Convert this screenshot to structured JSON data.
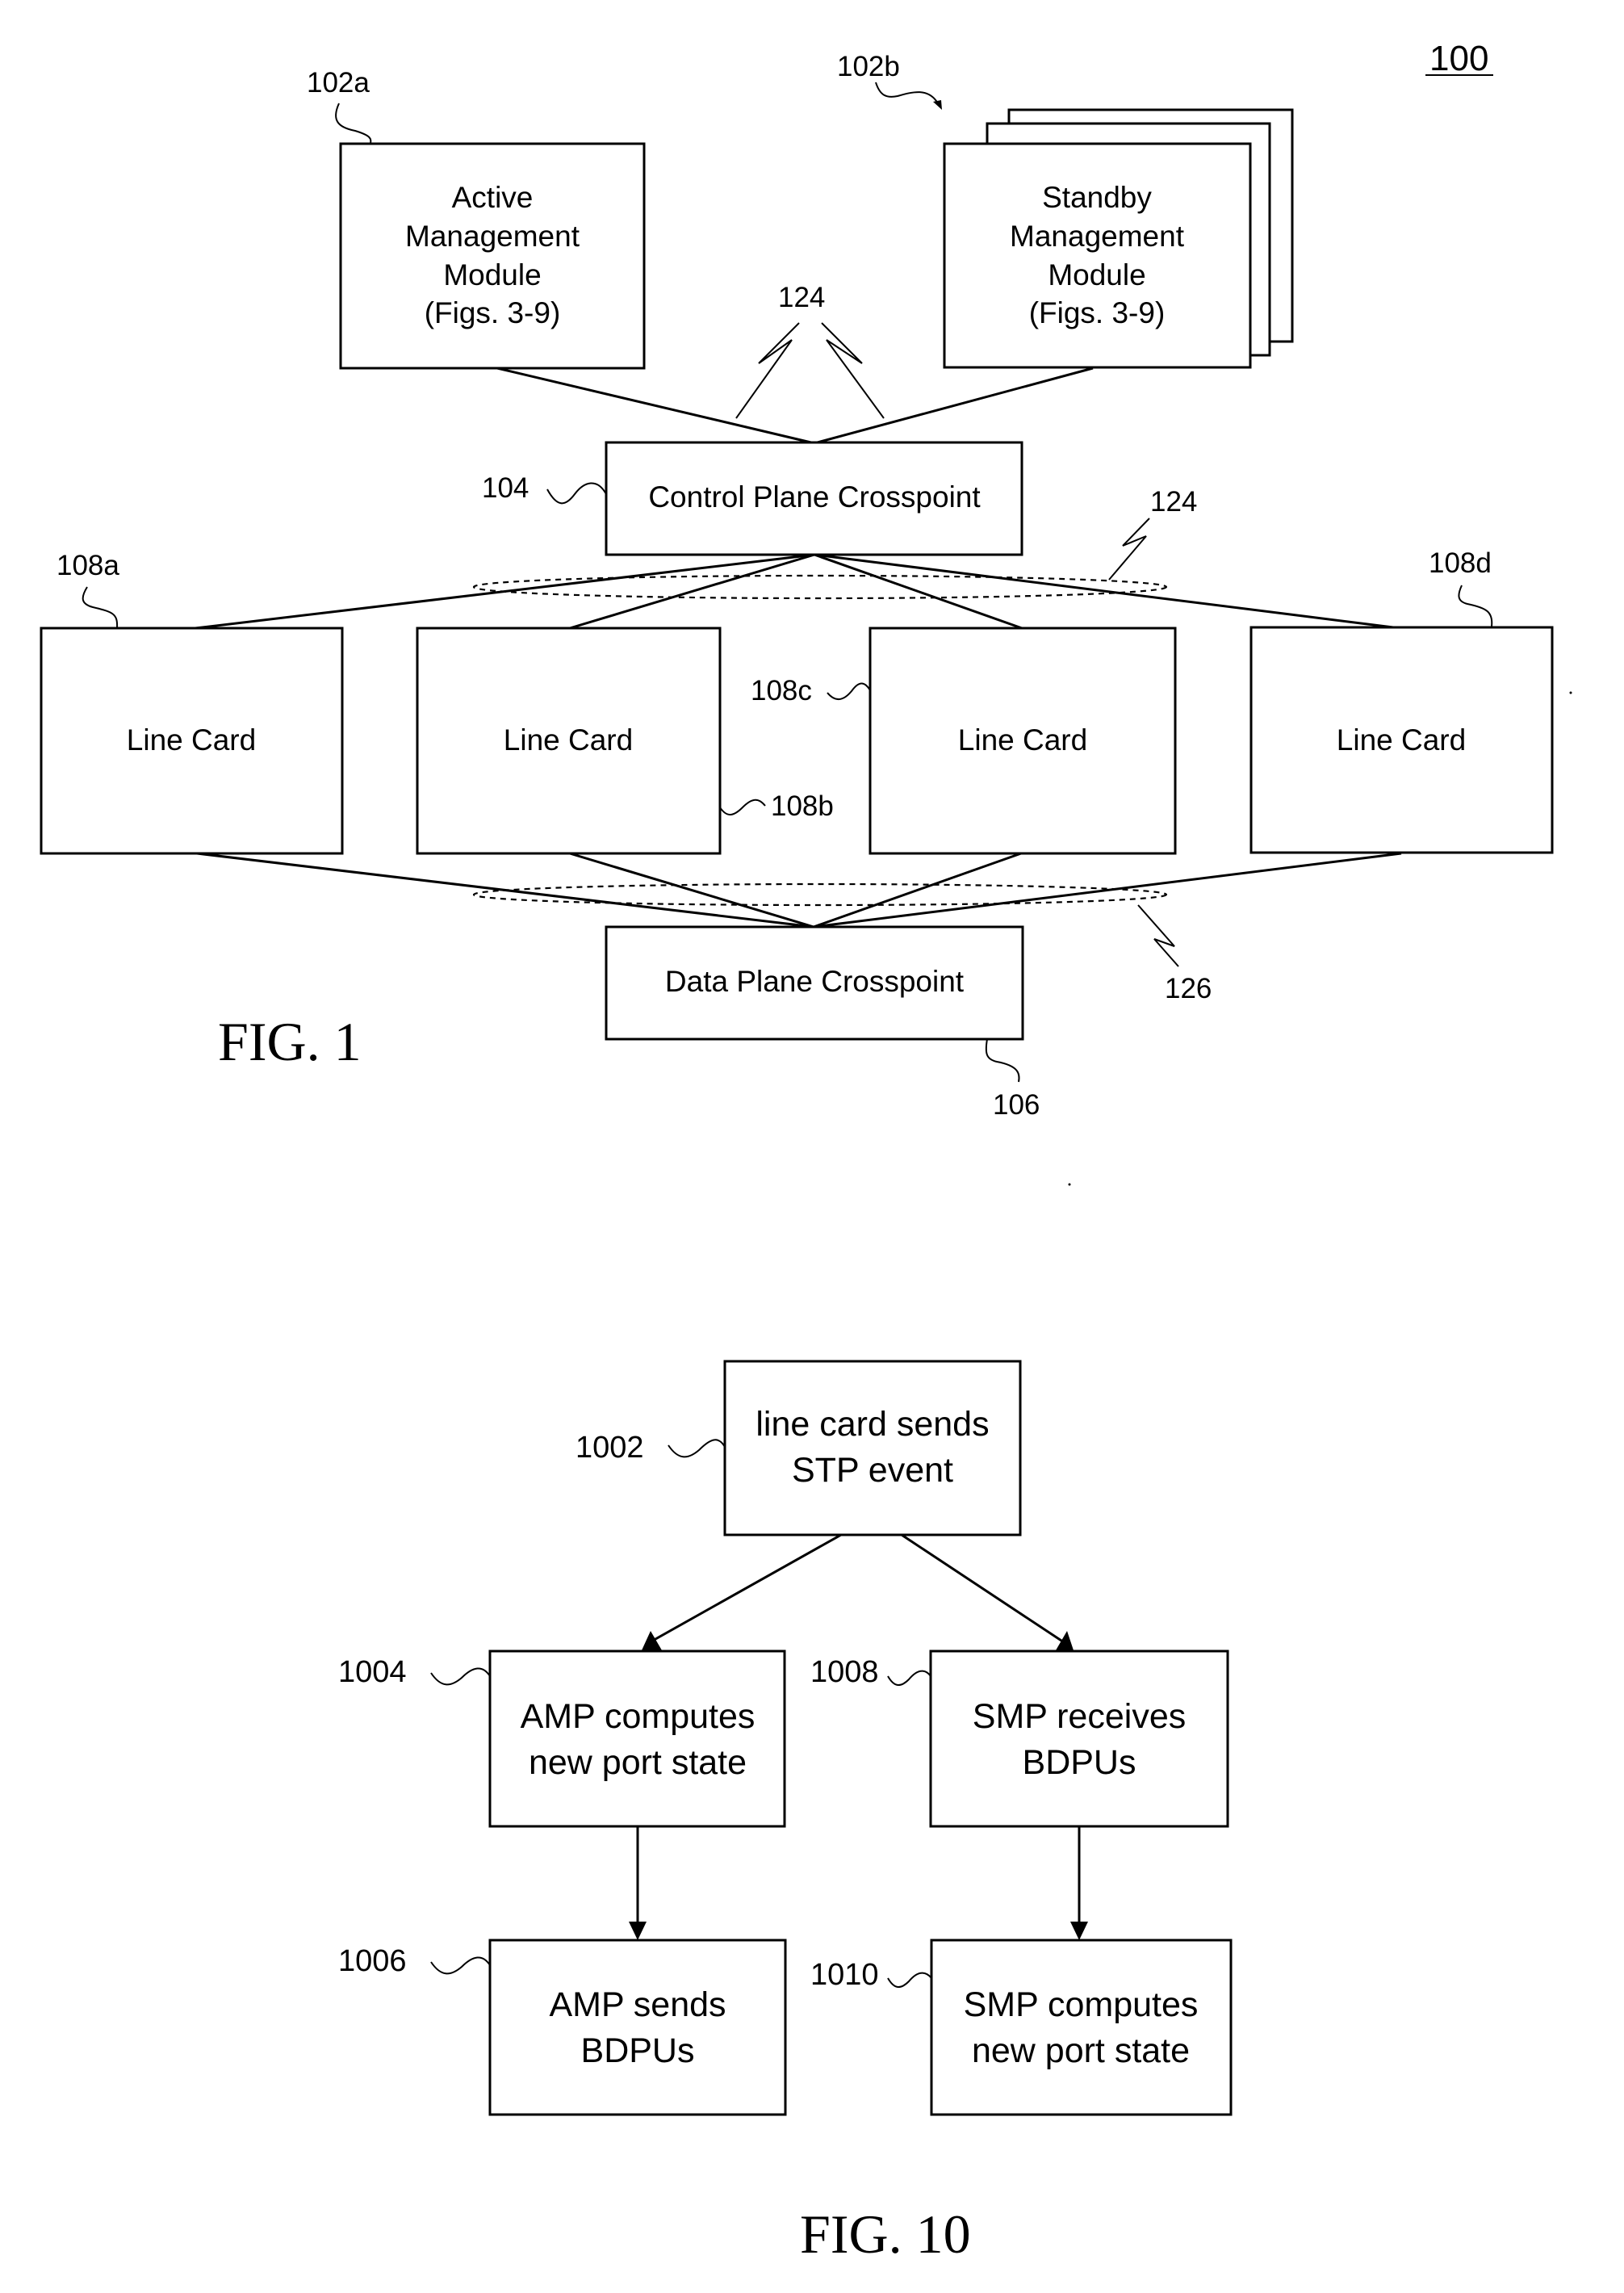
{
  "figure_1": {
    "caption": "FIG. 1",
    "system_ref": "100",
    "active_module": {
      "ref": "102a",
      "lines": [
        "Active",
        "Management",
        "Module",
        "(Figs. 3-9)"
      ]
    },
    "standby_module": {
      "ref": "102b",
      "lines": [
        "Standby",
        "Management",
        "Module",
        "(Figs. 3-9)"
      ]
    },
    "control_plane": {
      "ref": "104",
      "label": "Control Plane Crosspoint"
    },
    "data_plane": {
      "ref": "106",
      "label": "Data Plane Crosspoint"
    },
    "control_links_ref_upper": "124",
    "control_links_ref_lower": "124",
    "data_links_ref": "126",
    "line_cards": [
      {
        "ref": "108a",
        "label": "Line Card"
      },
      {
        "ref": "108b",
        "label": "Line Card"
      },
      {
        "ref": "108c",
        "label": "Line Card"
      },
      {
        "ref": "108d",
        "label": "Line Card"
      }
    ]
  },
  "figure_10": {
    "caption": "FIG. 10",
    "steps": [
      {
        "ref": "1002",
        "lines": [
          "line card sends",
          "STP event"
        ]
      },
      {
        "ref": "1004",
        "lines": [
          "AMP computes",
          "new port state"
        ]
      },
      {
        "ref": "1006",
        "lines": [
          "AMP sends",
          "BDPUs"
        ]
      },
      {
        "ref": "1008",
        "lines": [
          "SMP receives",
          "BDPUs"
        ]
      },
      {
        "ref": "1010",
        "lines": [
          "SMP computes",
          "new port state"
        ]
      }
    ]
  }
}
